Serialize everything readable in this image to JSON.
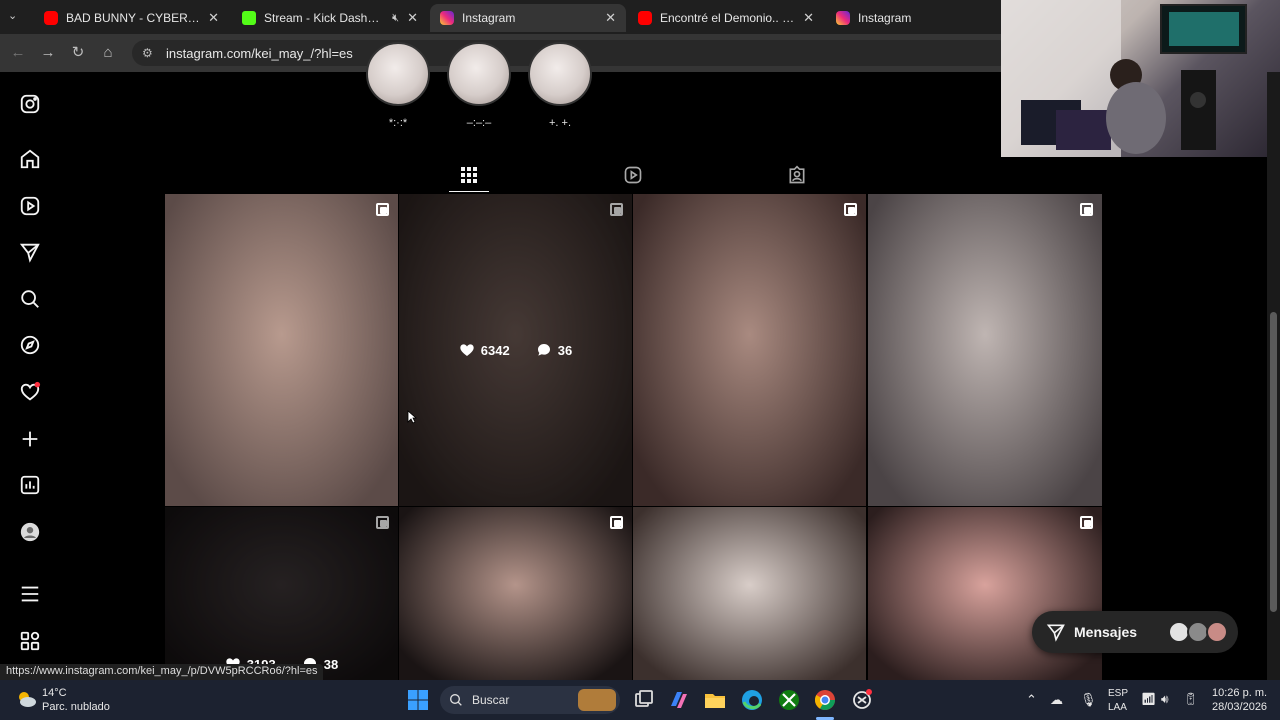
{
  "browser": {
    "tabs": [
      {
        "title": "BAD BUNNY - CYBERTRUCK (V",
        "icon": "youtube-icon"
      },
      {
        "title": "Stream - Kick Dashboard",
        "icon": "kick-icon"
      },
      {
        "title": "Instagram",
        "icon": "instagram-icon"
      },
      {
        "title": "Encontré el Demonio.. || Capítu",
        "icon": "youtube-icon"
      },
      {
        "title": "Instagram",
        "icon": "instagram-icon"
      }
    ],
    "url": "instagram.com/kei_may_/?hl=es",
    "status_url": "https://www.instagram.com/kei_may_/p/DVW5pRCCRo6/?hl=es"
  },
  "highlights": [
    {
      "label": "*:·:*"
    },
    {
      "label": "–:–:–"
    },
    {
      "label": "+. +."
    }
  ],
  "posts": [
    {
      "tone": "#b89a8e",
      "tone2": "#5c4b48",
      "multi": true
    },
    {
      "tone": "#6b5852",
      "tone2": "#2a211f",
      "multi": true,
      "likes": "6342",
      "comments": "36"
    },
    {
      "tone": "#a98a80",
      "tone2": "#3b2a28",
      "multi": true
    },
    {
      "tone": "#bfb5b2",
      "tone2": "#4b4446",
      "multi": true
    },
    {
      "tone": "#3a3334",
      "tone2": "#151112",
      "multi": true,
      "likes": "3193",
      "comments": "38"
    },
    {
      "tone": "#b4948a",
      "tone2": "#1a1414",
      "multi": true
    },
    {
      "tone": "#d8cdc8",
      "tone2": "#3c302d",
      "multi": false
    },
    {
      "tone": "#d8a29c",
      "tone2": "#2c1e1e",
      "multi": true
    }
  ],
  "messages": {
    "label": "Mensajes"
  },
  "taskbar": {
    "weather_temp": "14°C",
    "weather_desc": "Parc. nublado",
    "search_label": "Buscar",
    "lang_top": "ESP",
    "lang_bottom": "LAA",
    "time": "10:26 p. m.",
    "date": "28/03/2026"
  },
  "colors": {
    "accent": "#0095f6",
    "notification": "#ff3040"
  }
}
